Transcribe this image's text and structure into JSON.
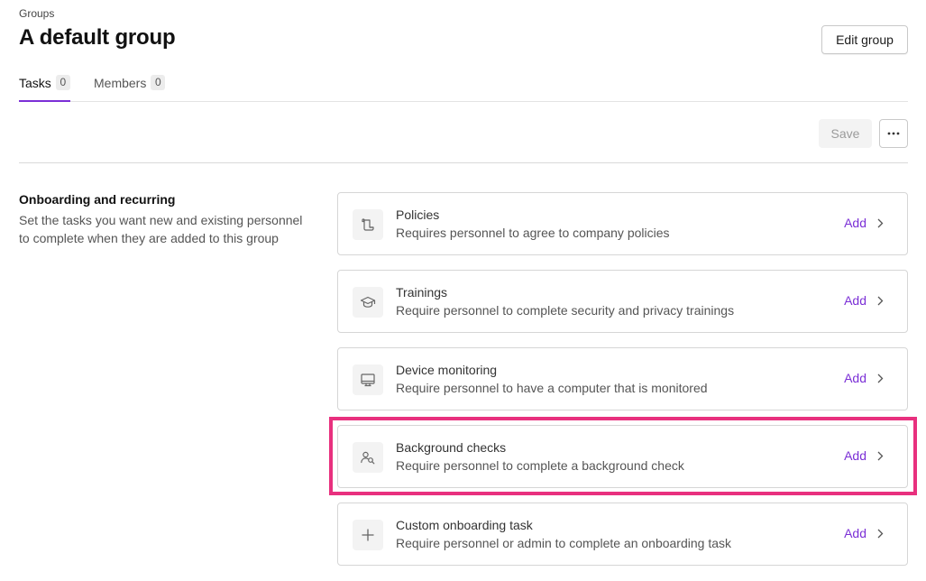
{
  "breadcrumb": "Groups",
  "title": "A default group",
  "edit_button": "Edit group",
  "tabs": [
    {
      "label": "Tasks",
      "count": "0",
      "active": true
    },
    {
      "label": "Members",
      "count": "0",
      "active": false
    }
  ],
  "toolbar": {
    "save_label": "Save",
    "more_icon": "ellipsis-icon"
  },
  "section": {
    "title": "Onboarding and recurring",
    "description": "Set the tasks you want new and existing personnel to complete when they are added to this group"
  },
  "cards": [
    {
      "icon": "policy-scroll-icon",
      "title": "Policies",
      "description": "Requires personnel to agree to company policies",
      "action": "Add"
    },
    {
      "icon": "graduation-cap-icon",
      "title": "Trainings",
      "description": "Require personnel to complete security and privacy trainings",
      "action": "Add"
    },
    {
      "icon": "monitor-icon",
      "title": "Device monitoring",
      "description": "Require personnel to have a computer that is monitored",
      "action": "Add"
    },
    {
      "icon": "person-search-icon",
      "title": "Background checks",
      "description": "Require personnel to complete a background check",
      "action": "Add"
    },
    {
      "icon": "plus-icon",
      "title": "Custom onboarding task",
      "description": "Require personnel or admin to complete an onboarding task",
      "action": "Add"
    }
  ],
  "colors": {
    "accent": "#7b2fd6",
    "highlight": "#e8307e"
  }
}
